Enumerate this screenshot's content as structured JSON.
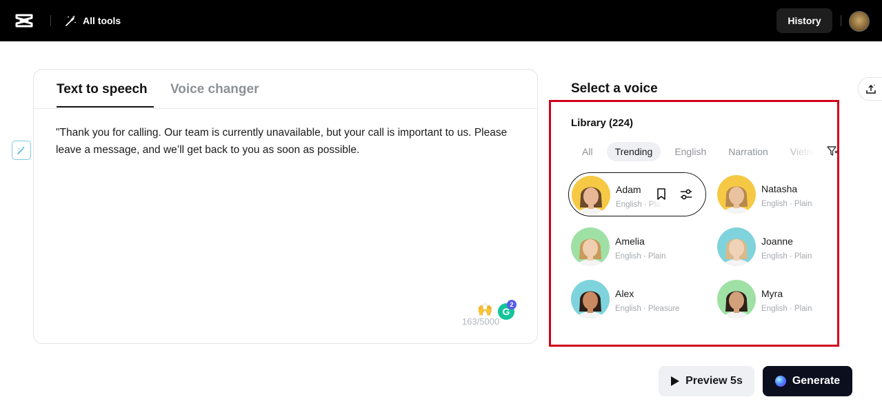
{
  "header": {
    "all_tools_label": "All tools",
    "history_label": "History"
  },
  "editor": {
    "tabs": [
      {
        "label": "Text to speech",
        "active": true
      },
      {
        "label": "Voice changer",
        "active": false
      }
    ],
    "text": "\"Thank you for calling. Our team is currently unavailable, but your call is important to us. Please leave a message, and we’ll get back to you as soon as possible.",
    "char_count": "163/5000",
    "grammarly_badge": "2"
  },
  "voice_panel": {
    "title": "Select a voice",
    "library_label": "Library (224)",
    "filters": [
      {
        "label": "All",
        "active": false
      },
      {
        "label": "Trending",
        "active": true
      },
      {
        "label": "English",
        "active": false
      },
      {
        "label": "Narration",
        "active": false
      },
      {
        "label": "Vietnam",
        "active": false
      }
    ],
    "voices": [
      {
        "name": "Adam",
        "meta": "English · Plain",
        "bg": "#f6c944",
        "skin": "#e8b896",
        "hair": "#6b4a2e"
      },
      {
        "name": "Natasha",
        "meta": "English · Plain",
        "bg": "#f6c944",
        "skin": "#e9c2a0",
        "hair": "#b8894e"
      },
      {
        "name": "Amelia",
        "meta": "English · Plain",
        "bg": "#9fe0a5",
        "skin": "#efcfb0",
        "hair": "#c99a5a"
      },
      {
        "name": "Joanne",
        "meta": "English · Plain",
        "bg": "#7fd3dc",
        "skin": "#f0d2b8",
        "hair": "#d8b98a"
      },
      {
        "name": "Alex",
        "meta": "English · Pleasure",
        "bg": "#7fd3dc",
        "skin": "#c98a62",
        "hair": "#2e1f16"
      },
      {
        "name": "Myra",
        "meta": "English · Plain",
        "bg": "#9fe0a5",
        "skin": "#d3a07c",
        "hair": "#2e2018"
      }
    ]
  },
  "actions": {
    "preview_label": "Preview 5s",
    "generate_label": "Generate"
  }
}
